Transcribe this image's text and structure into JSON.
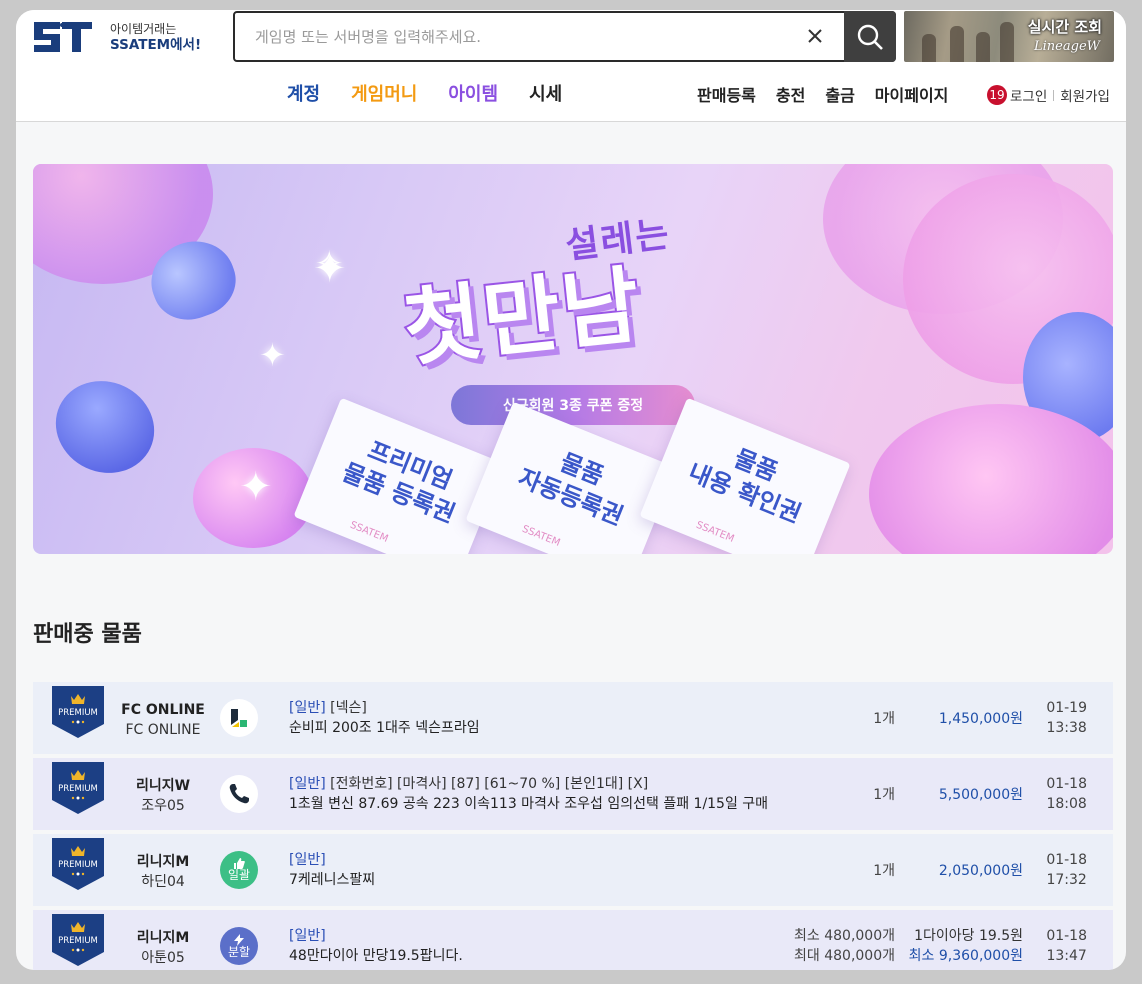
{
  "header": {
    "logo": {
      "mark": "ST",
      "tagline": "아이템거래는",
      "brand": "SSATEM에서!"
    },
    "search": {
      "placeholder": "게임명 또는 서버명을 입력해주세요.",
      "value": ""
    },
    "realtime_banner": {
      "title": "실시간 조회",
      "subtitle": "LineageW"
    },
    "game_nav": [
      {
        "label": "계정",
        "color": "#1f4fa8"
      },
      {
        "label": "게임머니",
        "color": "#f39a12"
      },
      {
        "label": "아이템",
        "color": "#8a4fe0"
      },
      {
        "label": "시세",
        "color": "#222222"
      }
    ],
    "user_nav": [
      "판매등록",
      "충전",
      "출금",
      "마이페이지"
    ],
    "auth": {
      "age_badge": "19",
      "login": "로그인",
      "signup": "회원가입"
    }
  },
  "hero": {
    "title_small": "설레는",
    "title_big": "첫만남",
    "pill": "신규회원 3종 쿠폰 증정",
    "coupons": [
      {
        "line1": "프리미엄",
        "line2": "물품 등록권",
        "brand": "SSATEM"
      },
      {
        "line1": "물품",
        "line2": "자동등록권",
        "brand": "SSATEM"
      },
      {
        "line1": "물품",
        "line2": "내용 확인권",
        "brand": "SSATEM"
      }
    ]
  },
  "section_title": "판매중 물품",
  "listings": [
    {
      "badge": "PREMIUM",
      "game": "FC ONLINE",
      "server": "FC ONLINE",
      "type_icon": "nexon-logo-icon",
      "category": "[일반]",
      "tags": "[넥슨]",
      "title": "순비피 200조 1대주 넥슨프라임",
      "quantity": "1개",
      "price": "1,450,000원",
      "date": "01-19",
      "time": "13:38"
    },
    {
      "badge": "PREMIUM",
      "game": "리니지W",
      "server": "조우05",
      "type_icon": "phone-icon",
      "category": "[일반]",
      "tags": "[전화번호] [마격사] [87] [61~70 %] [본인1대] [X]",
      "title": "1초월 변신 87.69 공속 223 이속113 마격사 조우섭 임의선택 플패 1/15일 구매",
      "quantity": "1개",
      "price": "5,500,000원",
      "date": "01-18",
      "time": "18:08"
    },
    {
      "badge": "PREMIUM",
      "game": "리니지M",
      "server": "하딘04",
      "type_icon": "thumbs-up-icon",
      "type_label": "일괄",
      "category": "[일반]",
      "tags": "",
      "title": "7케레니스팔찌",
      "quantity": "1개",
      "price": "2,050,000원",
      "date": "01-18",
      "time": "17:32"
    },
    {
      "badge": "PREMIUM",
      "game": "리니지M",
      "server": "아툰05",
      "type_icon": "lightning-icon",
      "type_label": "분할",
      "category": "[일반]",
      "tags": "",
      "title": "48만다이아 만당19.5팝니다.",
      "quantity_min": "최소 480,000개",
      "quantity_max": "최대 480,000개",
      "unit_price": "1다이아당 19.5원",
      "min_price": "최소 9,360,000원",
      "date": "01-18",
      "time": "13:47"
    }
  ]
}
